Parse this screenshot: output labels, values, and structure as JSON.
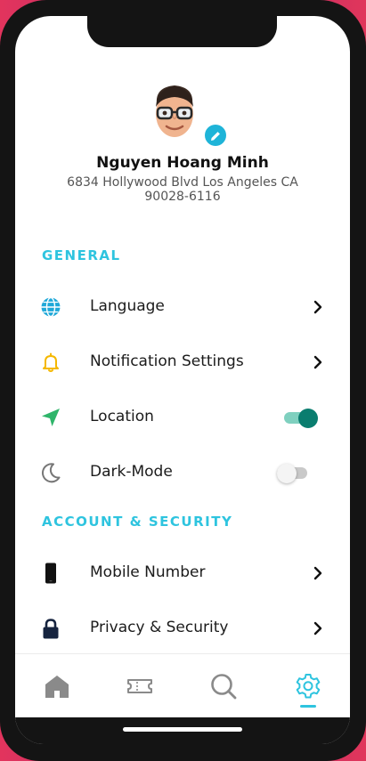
{
  "profile": {
    "name": "Nguyen Hoang Minh",
    "address": "6834 Hollywood Blvd Los Angeles CA 90028-6116"
  },
  "sections": {
    "general": "GENERAL",
    "account": "ACCOUNT & SECURITY"
  },
  "settings": {
    "language": "Language",
    "notifications": "Notification Settings",
    "location": "Location",
    "location_on": true,
    "dark_mode": "Dark-Mode",
    "dark_mode_on": false,
    "mobile_number": "Mobile Number",
    "privacy": "Privacy & Security"
  },
  "tabs": {
    "items": [
      "home-icon",
      "ticket-icon",
      "search-icon",
      "settings-icon"
    ],
    "active": "settings-icon"
  },
  "colors": {
    "accent": "#2ec4df",
    "toggle_on": "#0a7d6f",
    "bell": "#f5b800",
    "location_arrow": "#2fb56a",
    "globe": "#1fa8d8"
  }
}
